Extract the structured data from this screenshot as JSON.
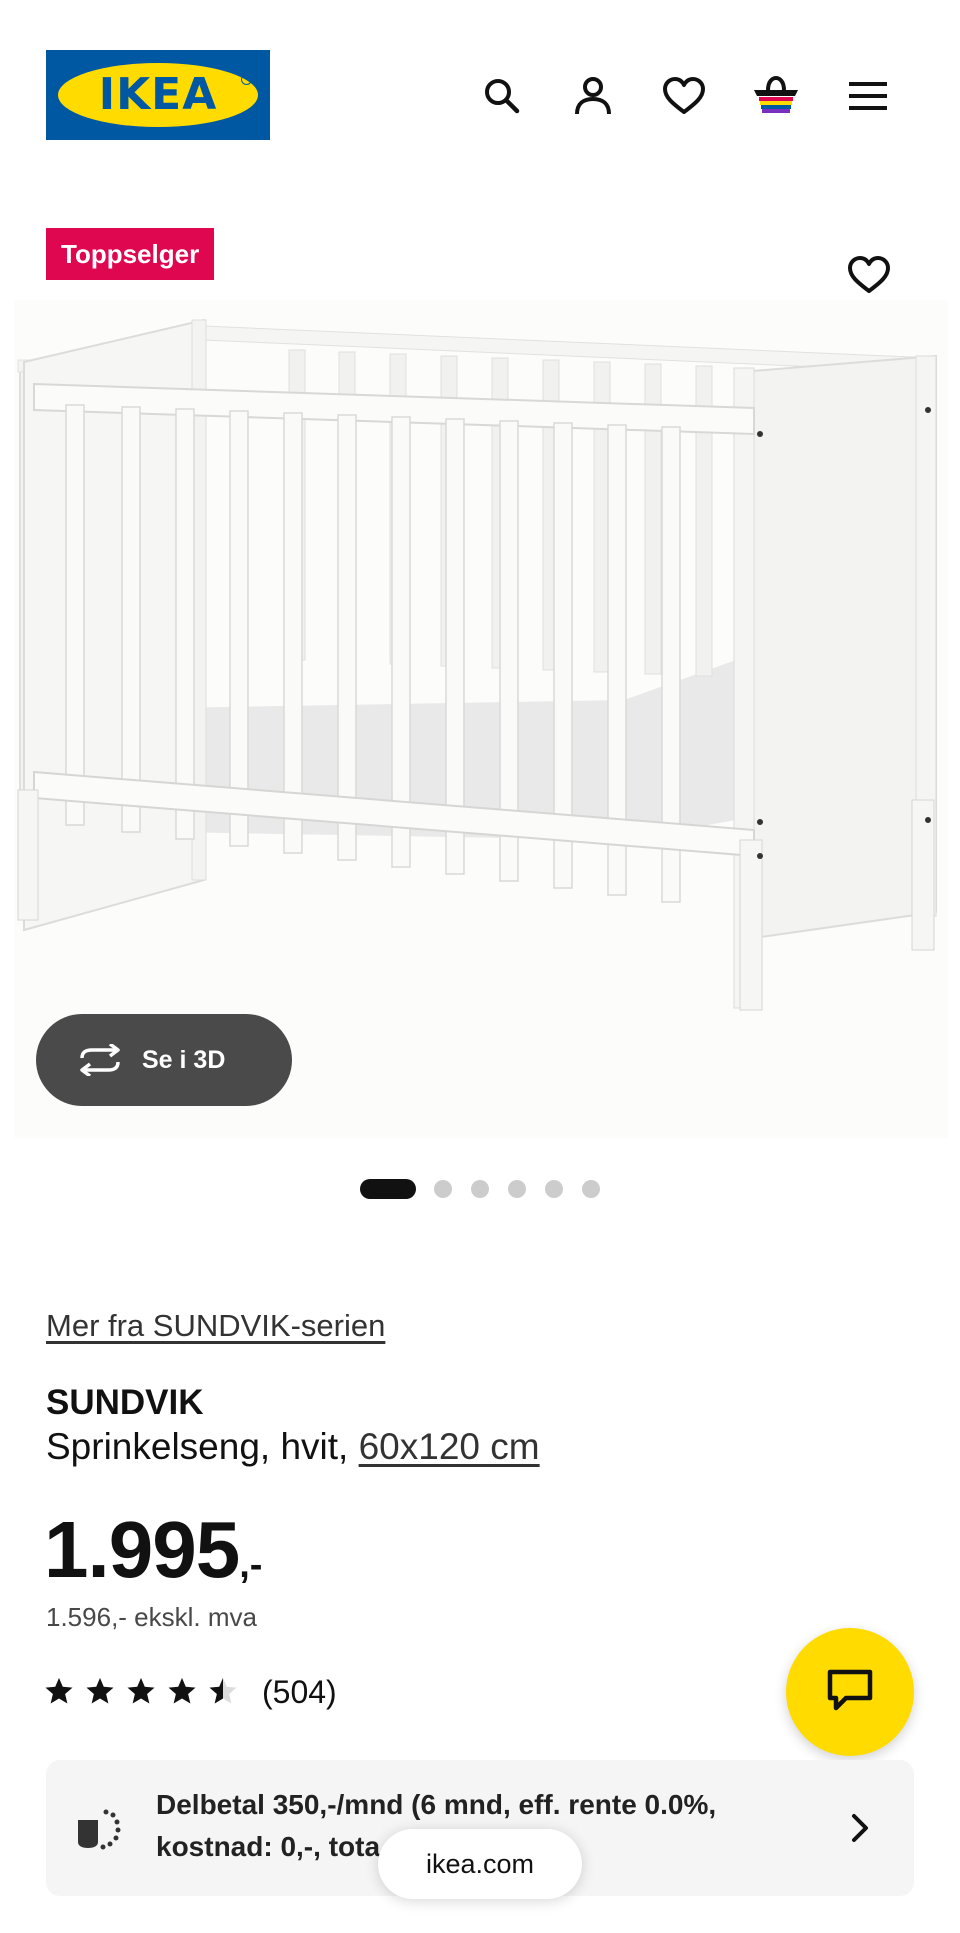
{
  "header": {
    "logo_text": "IKEA",
    "icons": [
      "search-icon",
      "user-icon",
      "heart-icon",
      "basket-icon",
      "menu-icon"
    ]
  },
  "product": {
    "badge": "Toppselger",
    "view_3d_label": "Se i 3D",
    "carousel": {
      "count": 6,
      "active_index": 1
    },
    "series_link": "Mer fra SUNDVIK-serien",
    "name": "SUNDVIK",
    "description": "Sprinkelseng, hvit,",
    "dimensions": "60x120 cm",
    "price_main": "1.995",
    "price_suffix": ",-",
    "price_ex_vat": "1.596,- ekskl. mva",
    "rating": 4.5,
    "review_count": "(504)"
  },
  "installment": {
    "line1": "Delbetal 350,-/mnd (6 mnd, eff. rente 0.0%,",
    "line2": "kostnad: 0,-, tota"
  },
  "browser": {
    "url": "ikea.com"
  },
  "colors": {
    "brand_blue": "#0058a3",
    "brand_yellow": "#ffdb00",
    "badge_red": "#e00751",
    "button_gray": "#4a4a4a"
  }
}
